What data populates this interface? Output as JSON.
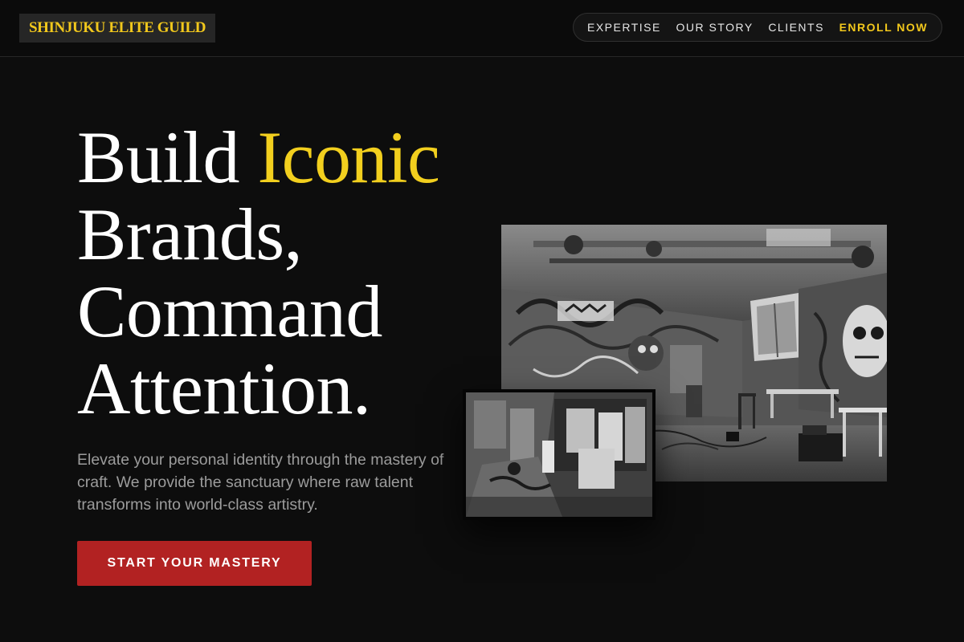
{
  "brand": {
    "name": "SHINJUKU ELITE GUILD"
  },
  "nav": {
    "items": [
      {
        "label": "EXPERTISE"
      },
      {
        "label": "OUR STORY"
      },
      {
        "label": "CLIENTS"
      }
    ],
    "cta_label": "ENROLL NOW"
  },
  "hero": {
    "headline_part1": "Build ",
    "headline_accent": "Iconic",
    "headline_line2": "Brands,",
    "headline_line3": "Command",
    "headline_line4": "Attention.",
    "subtext": "Elevate your personal identity through the mastery of craft. We provide the sanctuary where raw talent transforms into world-class artistry.",
    "cta_label": "START YOUR MASTERY"
  },
  "colors": {
    "background": "#0d0d0d",
    "accent_yellow": "#f2c81c",
    "cta_red": "#b22222",
    "muted_text": "#9c9c9c"
  }
}
